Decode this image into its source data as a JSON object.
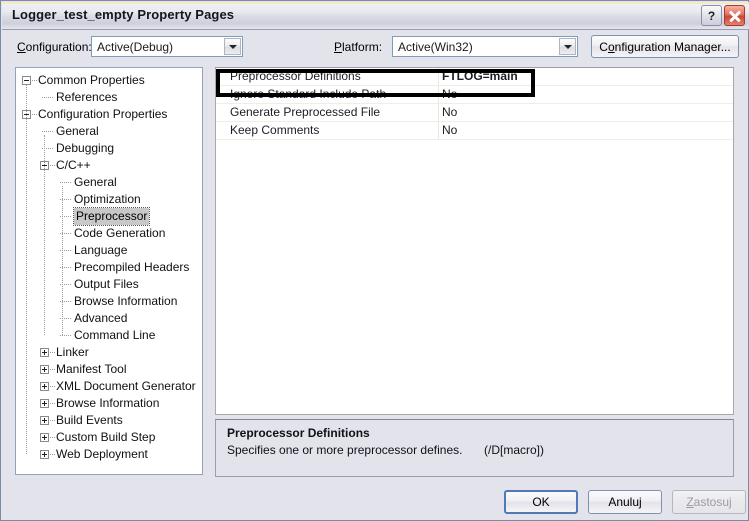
{
  "window": {
    "title": "Logger_test_empty Property Pages",
    "help_button": "?",
    "close_button": "×"
  },
  "config_bar": {
    "configuration_label": "Configuration:",
    "configuration_value": "Active(Debug)",
    "platform_label": "Platform:",
    "platform_value": "Active(Win32)",
    "configuration_manager_button": "Configuration Manager..."
  },
  "tree": {
    "selected": "Preprocessor",
    "items": [
      {
        "label": "Common Properties",
        "depth": 0,
        "state": "expanded"
      },
      {
        "label": "References",
        "depth": 1,
        "state": "leaf"
      },
      {
        "label": "Configuration Properties",
        "depth": 0,
        "state": "expanded"
      },
      {
        "label": "General",
        "depth": 1,
        "state": "leaf"
      },
      {
        "label": "Debugging",
        "depth": 1,
        "state": "leaf"
      },
      {
        "label": "C/C++",
        "depth": 1,
        "state": "expanded"
      },
      {
        "label": "General",
        "depth": 2,
        "state": "leaf"
      },
      {
        "label": "Optimization",
        "depth": 2,
        "state": "leaf"
      },
      {
        "label": "Preprocessor",
        "depth": 2,
        "state": "leaf"
      },
      {
        "label": "Code Generation",
        "depth": 2,
        "state": "leaf"
      },
      {
        "label": "Language",
        "depth": 2,
        "state": "leaf"
      },
      {
        "label": "Precompiled Headers",
        "depth": 2,
        "state": "leaf"
      },
      {
        "label": "Output Files",
        "depth": 2,
        "state": "leaf"
      },
      {
        "label": "Browse Information",
        "depth": 2,
        "state": "leaf"
      },
      {
        "label": "Advanced",
        "depth": 2,
        "state": "leaf"
      },
      {
        "label": "Command Line",
        "depth": 2,
        "state": "leaf"
      },
      {
        "label": "Linker",
        "depth": 1,
        "state": "collapsed"
      },
      {
        "label": "Manifest Tool",
        "depth": 1,
        "state": "collapsed"
      },
      {
        "label": "XML Document Generator",
        "depth": 1,
        "state": "collapsed"
      },
      {
        "label": "Browse Information",
        "depth": 1,
        "state": "collapsed"
      },
      {
        "label": "Build Events",
        "depth": 1,
        "state": "collapsed"
      },
      {
        "label": "Custom Build Step",
        "depth": 1,
        "state": "collapsed"
      },
      {
        "label": "Web Deployment",
        "depth": 1,
        "state": "collapsed"
      }
    ]
  },
  "grid": {
    "rows": [
      {
        "name": "Preprocessor Definitions",
        "value": "FTLOG=main",
        "bold": true
      },
      {
        "name": "Ignore Standard Include Path",
        "value": "No",
        "bold": false
      },
      {
        "name": "Generate Preprocessed File",
        "value": "No",
        "bold": false
      },
      {
        "name": "Keep Comments",
        "value": "No",
        "bold": false
      }
    ]
  },
  "annotation": {
    "shape": "rectangle",
    "color": "#000000",
    "highlights_row": "Preprocessor Definitions"
  },
  "description": {
    "title": "Preprocessor Definitions",
    "text": "Specifies one or more preprocessor defines.",
    "flag": "(/D[macro])"
  },
  "footer": {
    "ok": "OK",
    "cancel": "Anuluj",
    "apply": "Zastosuj",
    "apply_enabled": false
  }
}
